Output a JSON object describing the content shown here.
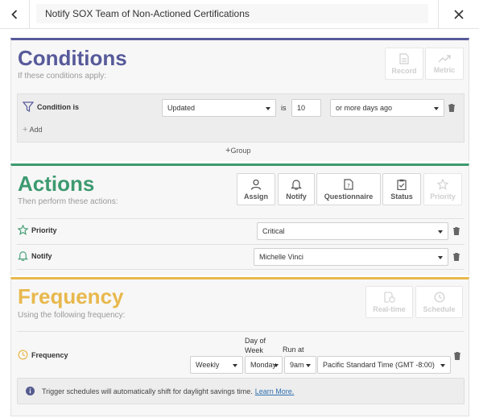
{
  "header": {
    "title": "Notify SOX Team of Non-Actioned Certifications"
  },
  "conditions": {
    "title": "Conditions",
    "subtitle": "If these conditions apply:",
    "buttons": {
      "record": "Record",
      "metric": "Metric"
    },
    "row": {
      "label": "Condition is",
      "field": "Updated",
      "operator": "is",
      "value": "10",
      "qualifier": "or more days ago"
    },
    "add": "Add",
    "group": "Group"
  },
  "actions": {
    "title": "Actions",
    "subtitle": "Then perform these actions:",
    "buttons": {
      "assign": "Assign",
      "notify": "Notify",
      "questionnaire": "Questionnaire",
      "status": "Status",
      "priority": "Priority"
    },
    "rows": [
      {
        "label": "Priority",
        "value": "Critical"
      },
      {
        "label": "Notify",
        "value": "Michelle Vinci"
      }
    ]
  },
  "frequency": {
    "title": "Frequency",
    "subtitle": "Using the following frequency:",
    "buttons": {
      "realtime": "Real-time",
      "schedule": "Schedule"
    },
    "row": {
      "label": "Frequency",
      "day_header_1": "Day of",
      "day_header_2": "Week",
      "run_header": "Run at",
      "period": "Weekly",
      "day": "Monday",
      "time": "9am",
      "timezone": "Pacific Standard Time (GMT -8:00)"
    },
    "info_text": "Trigger schedules will automatically shift for daylight savings time.",
    "info_link": "Learn More."
  },
  "colors": {
    "conditions": "#575a9a",
    "actions": "#3d9a70",
    "frequency": "#e8b84d",
    "link": "#2f6fb0"
  }
}
